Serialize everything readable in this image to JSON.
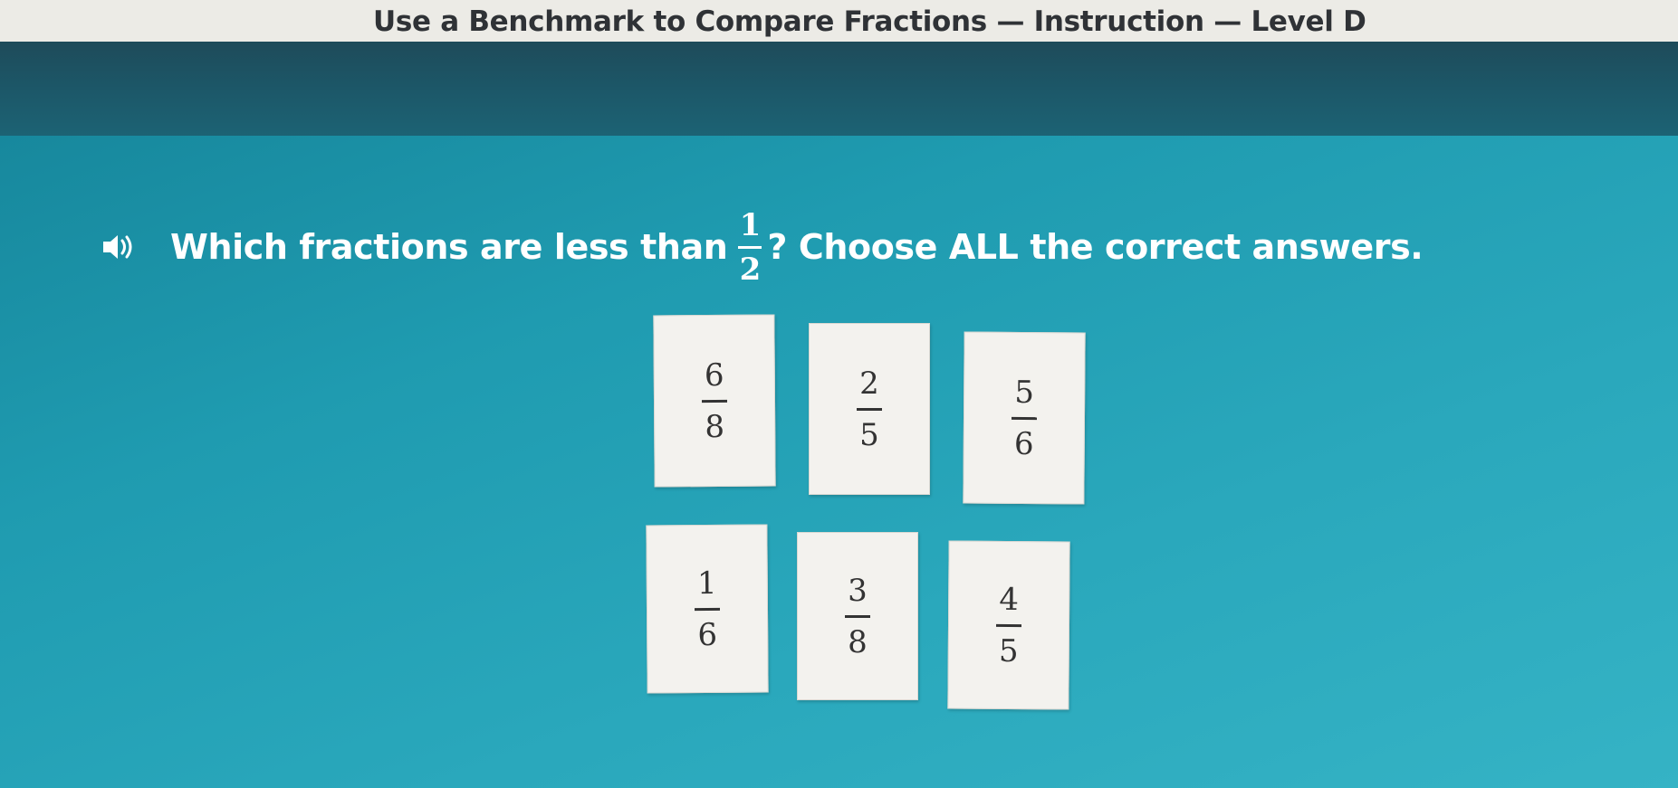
{
  "window": {
    "title": "Use a Benchmark to Compare Fractions — Instruction — Level D"
  },
  "question": {
    "audio_icon": "speaker-icon",
    "text_before": "Which fractions are less than",
    "benchmark": {
      "numerator": "1",
      "denominator": "2"
    },
    "text_after": "? Choose ALL the correct answers."
  },
  "choices": [
    {
      "numerator": "6",
      "denominator": "8"
    },
    {
      "numerator": "2",
      "denominator": "5"
    },
    {
      "numerator": "5",
      "denominator": "6"
    },
    {
      "numerator": "1",
      "denominator": "6"
    },
    {
      "numerator": "3",
      "denominator": "8"
    },
    {
      "numerator": "4",
      "denominator": "5"
    }
  ],
  "colors": {
    "background": "#2aa3b8",
    "header_band": "#1e4b5a",
    "title_bar": "#ecebe6",
    "card": "#f3f2ee"
  }
}
